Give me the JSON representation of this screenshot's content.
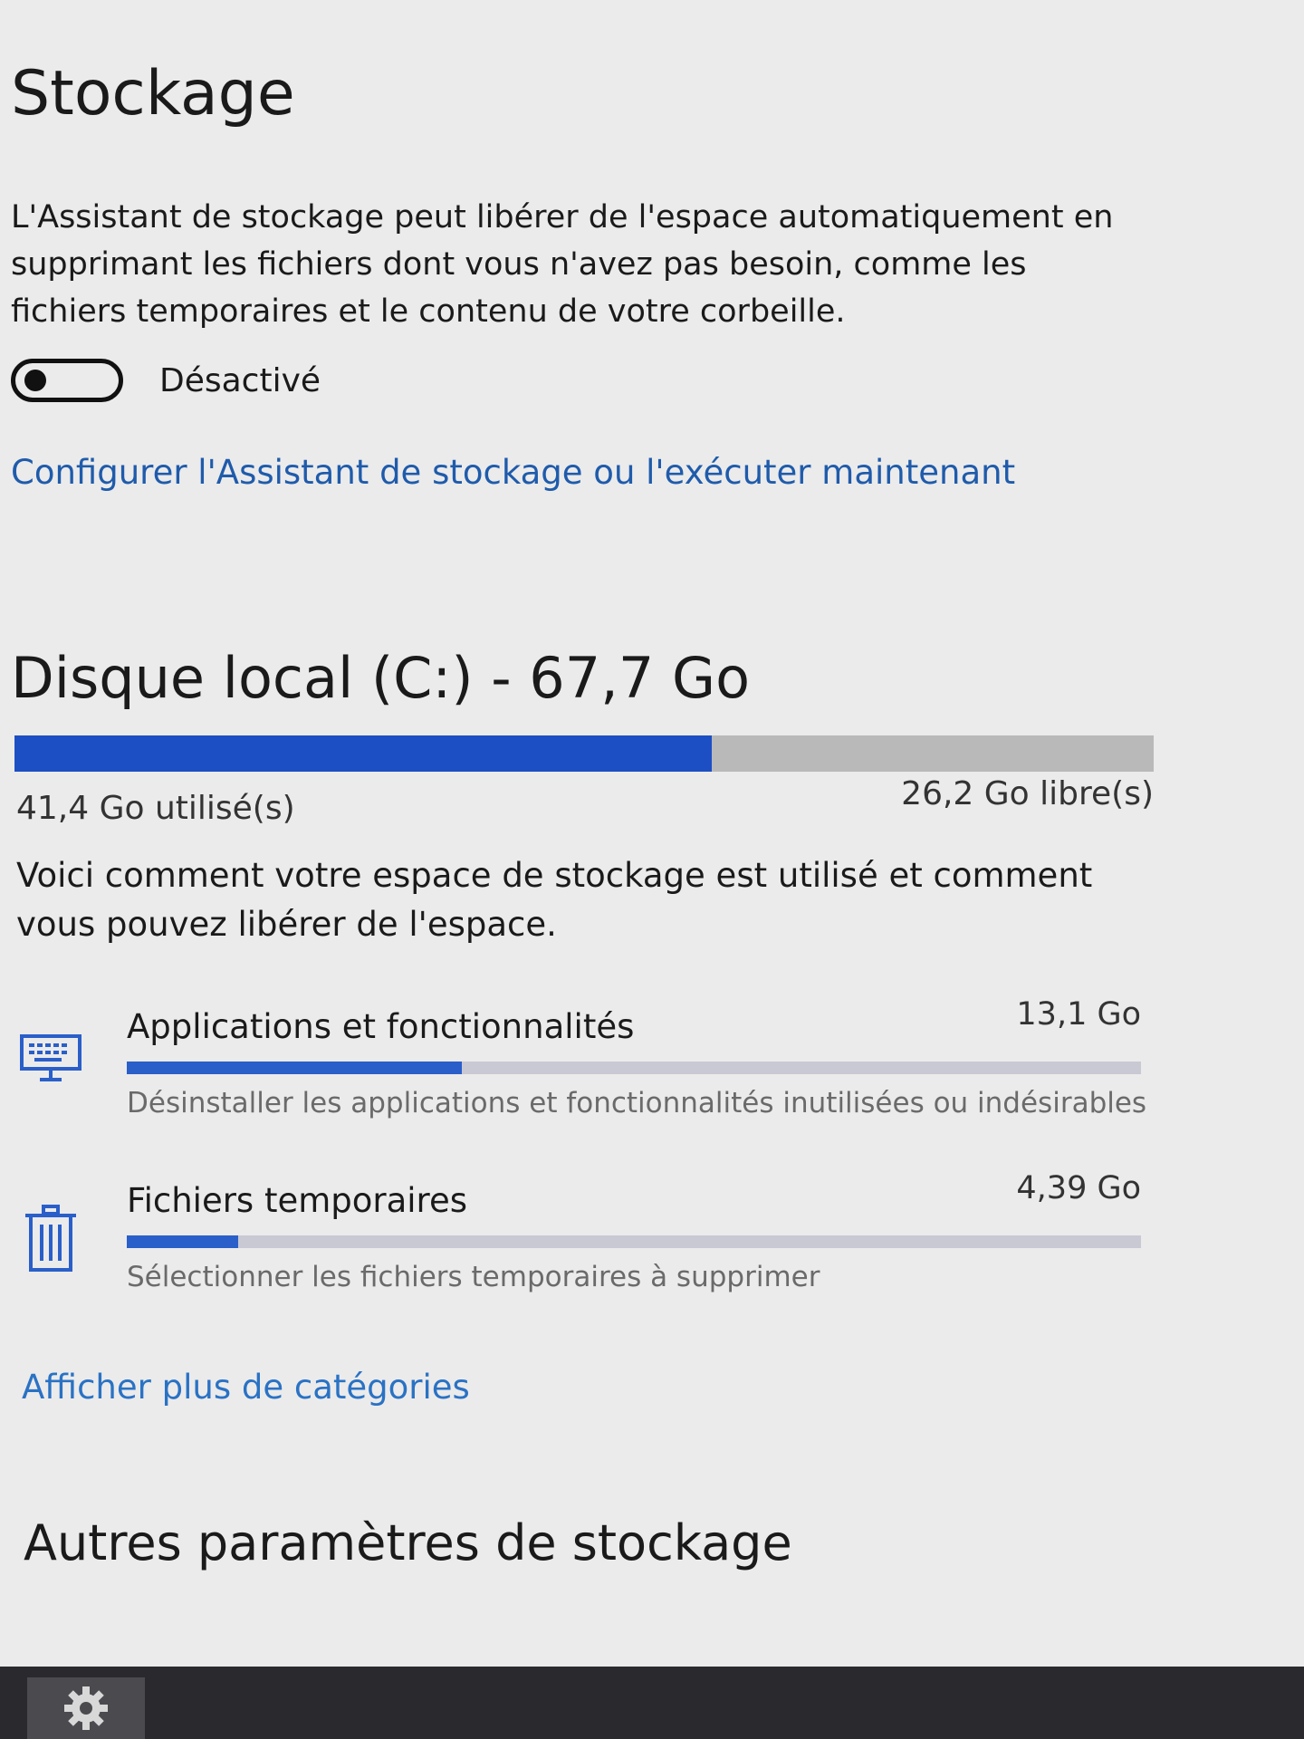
{
  "page": {
    "title": "Stockage"
  },
  "storage_sense": {
    "description": "L'Assistant de stockage peut libérer de l'espace automatiquement en supprimant les fichiers dont vous n'avez pas besoin, comme les fichiers temporaires et le contenu de votre corbeille.",
    "toggle_state": "Désactivé",
    "toggle_on": false,
    "configure_link": "Configurer l'Assistant de stockage ou l'exécuter maintenant"
  },
  "disk": {
    "title": "Disque local (C:) - 67,7 Go",
    "used_label": "41,4 Go utilisé(s)",
    "free_label": "26,2 Go libre(s)",
    "used_fraction": 0.612,
    "info": "Voici comment votre espace de stockage est utilisé et comment vous pouvez libérer de l'espace."
  },
  "categories": [
    {
      "name": "Applications et fonctionnalités",
      "size": "13,1 Go",
      "description": "Désinstaller les applications et fonctionnalités inutilisées ou indésirables",
      "icon": "monitor-keyboard-icon",
      "fraction": 0.33
    },
    {
      "name": "Fichiers temporaires",
      "size": "4,39 Go",
      "description": "Sélectionner les fichiers temporaires à supprimer",
      "icon": "trash-icon",
      "fraction": 0.11
    }
  ],
  "more_categories_link": "Afficher plus de catégories",
  "other_settings": {
    "title": "Autres paramètres de stockage"
  },
  "taskbar": {
    "settings_icon": "gear-icon"
  },
  "colors": {
    "accent": "#1d4fc4",
    "link": "#1f5bab",
    "bar_track": "#b9b9b9"
  }
}
